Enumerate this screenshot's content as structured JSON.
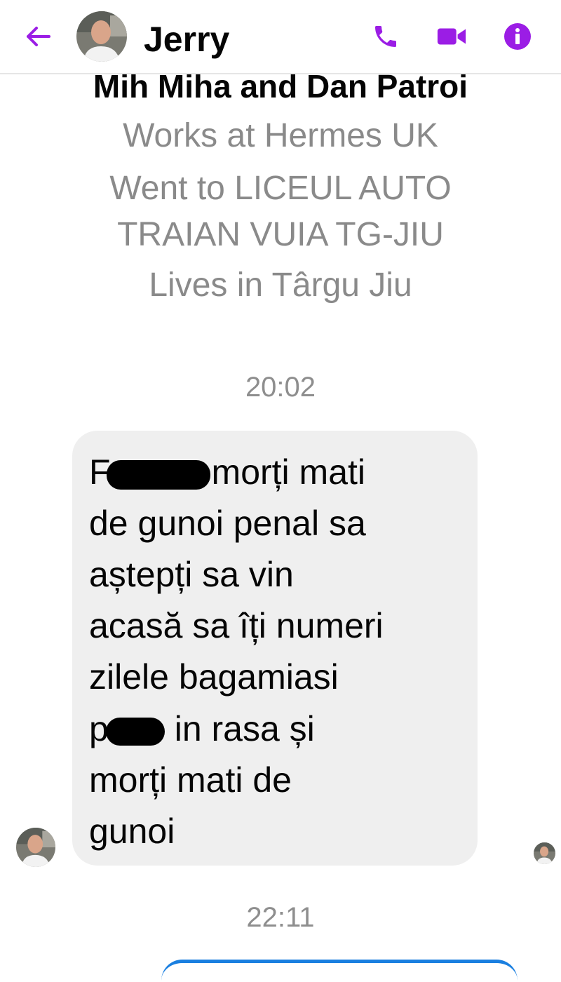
{
  "header": {
    "contact_name": "Jerry",
    "icons": {
      "back": "back-arrow-icon",
      "call": "phone-icon",
      "video": "video-camera-icon",
      "info": "info-icon"
    },
    "accent_color": "#9b1de5"
  },
  "profile": {
    "mutual_friends": "Mih Miha and Dan Patroi",
    "work": "Works at Hermes UK",
    "education_line1": "Went to LICEUL AUTO",
    "education_line2": "TRAIAN VUIA TG-JIU",
    "lives": "Lives in Târgu Jiu"
  },
  "conversation": {
    "timestamp_1": "20:02",
    "message": {
      "line1_start": "F",
      "line1_end": "morți mati",
      "line2": "de gunoi penal sa",
      "line3": "aștepți sa vin",
      "line4": "acasă sa îți numeri",
      "line5": "zilele bagamiasi",
      "line6_start": "p",
      "line6_end": " in rasa și",
      "line7": "morți mati de",
      "line8": "gunoi"
    },
    "timestamp_2": "22:11"
  }
}
